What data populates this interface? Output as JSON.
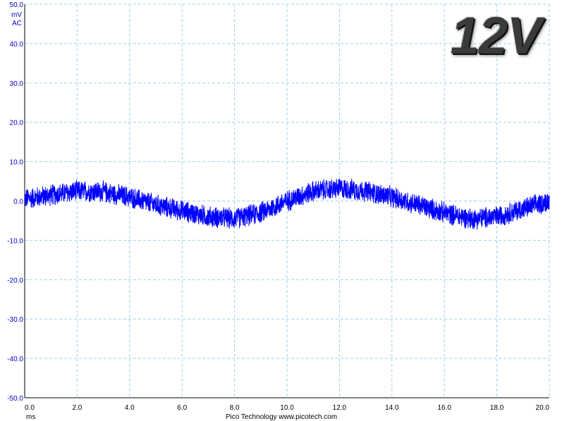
{
  "chart_data": {
    "type": "line",
    "y_unit": "mV",
    "y_coupling": "AC",
    "x_unit": "ms",
    "footer": "Pico Technology  www.picotech.com",
    "badge": "12V",
    "ylim": [
      -50,
      50
    ],
    "xlim": [
      0,
      20
    ],
    "y_ticks": [
      "50.0",
      "40.0",
      "30.0",
      "20.0",
      "10.0",
      "0.0",
      "-10.0",
      "-20.0",
      "-30.0",
      "-40.0",
      "-50.0"
    ],
    "x_ticks": [
      "0.0",
      "2.0",
      "4.0",
      "6.0",
      "8.0",
      "10.0",
      "12.0",
      "14.0",
      "16.0",
      "18.0",
      "20.0"
    ],
    "grid": true,
    "series": [
      {
        "color": "#0000ff",
        "x": [
          0,
          1,
          2,
          3,
          4,
          5,
          6,
          7,
          8,
          9,
          10,
          11,
          12,
          13,
          14,
          15,
          16,
          17,
          18,
          19,
          20
        ],
        "y": [
          0.5,
          1.5,
          2.5,
          2.3,
          1.0,
          -1.0,
          -2.5,
          -4.0,
          -4.5,
          -3.0,
          0.0,
          2.5,
          3.2,
          2.5,
          1.0,
          -1.0,
          -3.0,
          -4.5,
          -4.0,
          -2.0,
          0.0
        ],
        "noise_amplitude": 3.0
      }
    ]
  }
}
